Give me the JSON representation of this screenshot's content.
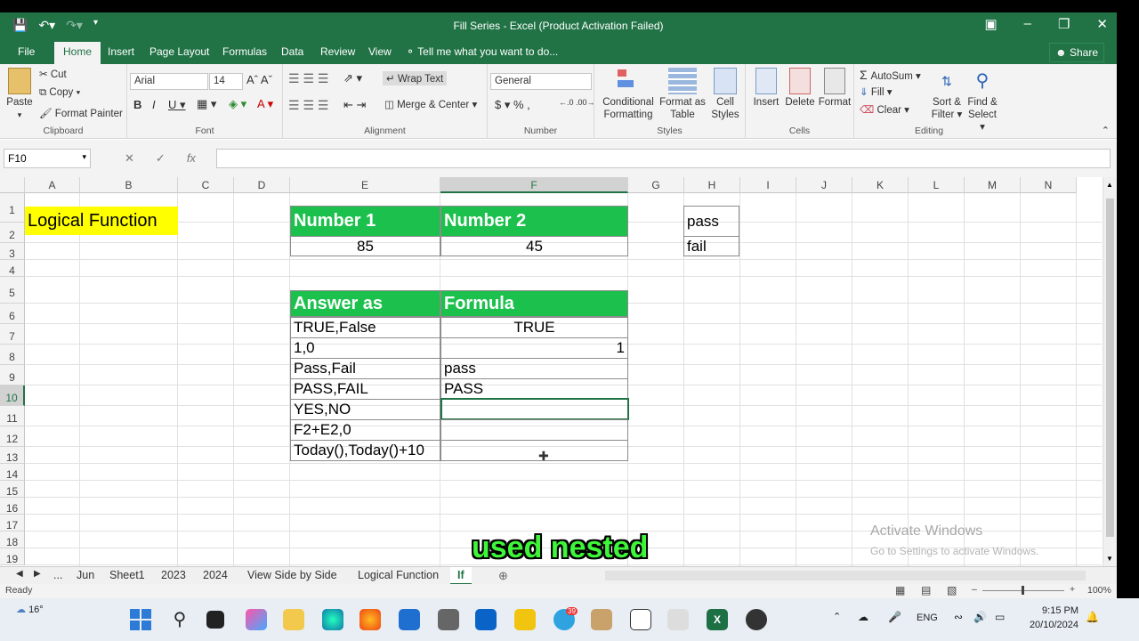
{
  "titlebar": {
    "title": "Fill Series - Excel (Product Activation Failed)"
  },
  "tabs": {
    "file": "File",
    "home": "Home",
    "insert": "Insert",
    "page_layout": "Page Layout",
    "formulas": "Formulas",
    "data": "Data",
    "review": "Review",
    "view": "View",
    "tell_me": "Tell me what you want to do...",
    "share": "Share"
  },
  "ribbon": {
    "clipboard": {
      "paste": "Paste",
      "cut": "Cut",
      "copy": "Copy",
      "format_painter": "Format Painter",
      "label": "Clipboard"
    },
    "font": {
      "name": "Arial",
      "size": "14",
      "label": "Font"
    },
    "alignment": {
      "wrap_text": "Wrap Text",
      "merge_center": "Merge & Center",
      "label": "Alignment"
    },
    "number": {
      "format": "General",
      "label": "Number"
    },
    "styles": {
      "conditional": "Conditional",
      "formatting": "Formatting",
      "format_as": "Format as",
      "table": "Table",
      "cell": "Cell",
      "cell_styles": "Styles",
      "label": "Styles"
    },
    "cells": {
      "insert": "Insert",
      "delete": "Delete",
      "format": "Format",
      "label": "Cells"
    },
    "editing": {
      "autosum": "AutoSum",
      "fill": "Fill",
      "clear": "Clear",
      "sort": "Sort &",
      "filter": "Filter",
      "find": "Find &",
      "select": "Select",
      "label": "Editing"
    }
  },
  "formula_bar": {
    "name_box": "F10",
    "fx": "fx",
    "content": ""
  },
  "columns": [
    "A",
    "B",
    "C",
    "D",
    "E",
    "F",
    "G",
    "H",
    "I",
    "J",
    "K",
    "L",
    "M",
    "N"
  ],
  "rows": [
    "1",
    "2",
    "3",
    "4",
    "5",
    "6",
    "7",
    "8",
    "9",
    "10",
    "11",
    "12",
    "13",
    "14",
    "15",
    "16",
    "17",
    "18",
    "19"
  ],
  "cells": {
    "A1": "Logical Function",
    "E1": "Number 1",
    "F1": "Number 2",
    "H1": "pass",
    "E2": "85",
    "F2": "45",
    "H2": "fail",
    "E5": "Answer as",
    "F5": "Formula",
    "E6": "TRUE,False",
    "F6": "TRUE",
    "E7": "1,0",
    "F7": "1",
    "E8": "Pass,Fail",
    "F8": "pass",
    "E9": "PASS,FAIL",
    "F9": "PASS",
    "E10": "YES,NO",
    "F10": "",
    "E11": "F2+E2,0",
    "F11": "",
    "E12": "Today(),Today()+10",
    "F12": ""
  },
  "sheet_tabs": {
    "more": "...",
    "items": [
      "Jun",
      "Sheet1",
      "2023",
      "2024",
      "View Side by Side",
      "Logical Function",
      "If"
    ],
    "active": "If"
  },
  "status": {
    "ready": "Ready",
    "zoom": "100%"
  },
  "watermark": {
    "line1": "Activate Windows",
    "line2": "Go to Settings to activate Windows."
  },
  "caption": "used nested",
  "taskbar": {
    "weather": "16°",
    "lang": "ENG",
    "time": "9:15 PM",
    "date": "20/10/2024",
    "badge": "39"
  },
  "colors": {
    "excel_green": "#217346",
    "header_green": "#1cc04d",
    "highlight_yellow": "#ffff00",
    "caption_green": "#3ef53a"
  }
}
